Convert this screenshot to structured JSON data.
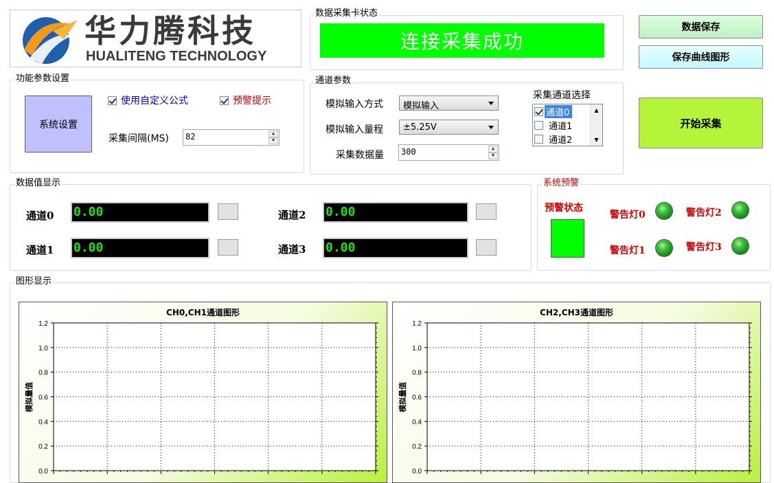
{
  "logo": {
    "cn": "华力腾科技",
    "en": "HUALITENG TECHNOLOGY"
  },
  "daq_status": {
    "title": "数据采集卡状态",
    "text": "连接采集成功",
    "color": "#00ff00"
  },
  "buttons": {
    "save_data": "数据保存",
    "save_curve": "保存曲线图形",
    "start": "开始采集"
  },
  "func_params": {
    "title": "功能参数设置",
    "system_settings": "系统设置",
    "custom_formula": "使用自定义公式",
    "warning_tip": "预警提示",
    "interval_label": "采集间隔(MS)",
    "interval_value": "82"
  },
  "channel_params": {
    "title": "通道参数",
    "input_mode_label": "模拟输入方式",
    "input_mode_value": "模拟输入",
    "input_range_label": "模拟输入量程",
    "input_range_value": "±5.25V",
    "sample_count_label": "采集数据量",
    "sample_count_value": "300",
    "channel_select_title": "采集通道选择",
    "channels": [
      {
        "label": "通道0",
        "checked": true
      },
      {
        "label": "通道1",
        "checked": false
      },
      {
        "label": "通道2",
        "checked": false
      }
    ]
  },
  "data_display": {
    "title": "数据值显示",
    "channels": [
      {
        "name": "通道0",
        "value": "0.00"
      },
      {
        "name": "通道1",
        "value": "0.00"
      },
      {
        "name": "通道2",
        "value": "0.00"
      },
      {
        "name": "通道3",
        "value": "0.00"
      }
    ]
  },
  "system_warning": {
    "title": "系统预警",
    "state_label": "预警状态",
    "state_color": "#00ff00",
    "lights": [
      "警告灯0",
      "警告灯1",
      "警告灯2",
      "警告灯3"
    ]
  },
  "graph_display": {
    "title": "图形显示"
  },
  "chart_data": [
    {
      "type": "line",
      "title": "CH0,CH1通道图形",
      "ylabel": "模拟量值",
      "xlabel": "",
      "ylim": [
        0.0,
        1.2
      ],
      "yticks": [
        "1.2",
        "1.0",
        "0.8",
        "0.6",
        "0.4",
        "0.2",
        "0.0"
      ],
      "grid": true,
      "series": []
    },
    {
      "type": "line",
      "title": "CH2,CH3通道图形",
      "ylabel": "模拟量值",
      "xlabel": "",
      "ylim": [
        0.0,
        1.2
      ],
      "yticks": [
        "1.2",
        "1.0",
        "0.8",
        "0.6",
        "0.4",
        "0.2",
        "0.0"
      ],
      "grid": true,
      "series": []
    }
  ]
}
